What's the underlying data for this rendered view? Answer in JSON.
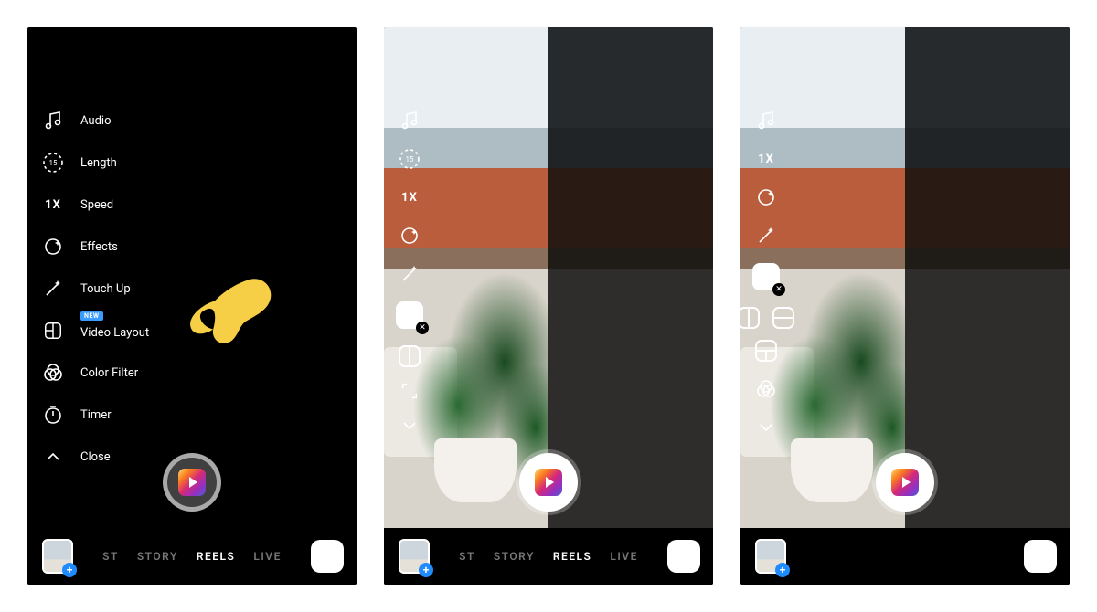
{
  "menu": {
    "audio": "Audio",
    "length": "Length",
    "length_value": "15",
    "speed": "Speed",
    "speed_value": "1X",
    "effects": "Effects",
    "touchup": "Touch Up",
    "video_layout": "Video Layout",
    "new_badge": "NEW",
    "color_filter": "Color Filter",
    "timer": "Timer",
    "close": "Close"
  },
  "modes": {
    "post_short": "ST",
    "story": "STORY",
    "reels": "REELS",
    "live": "LIVE"
  },
  "icons": {
    "speed_1x": "1X",
    "plus": "+",
    "close_x": "✕"
  }
}
